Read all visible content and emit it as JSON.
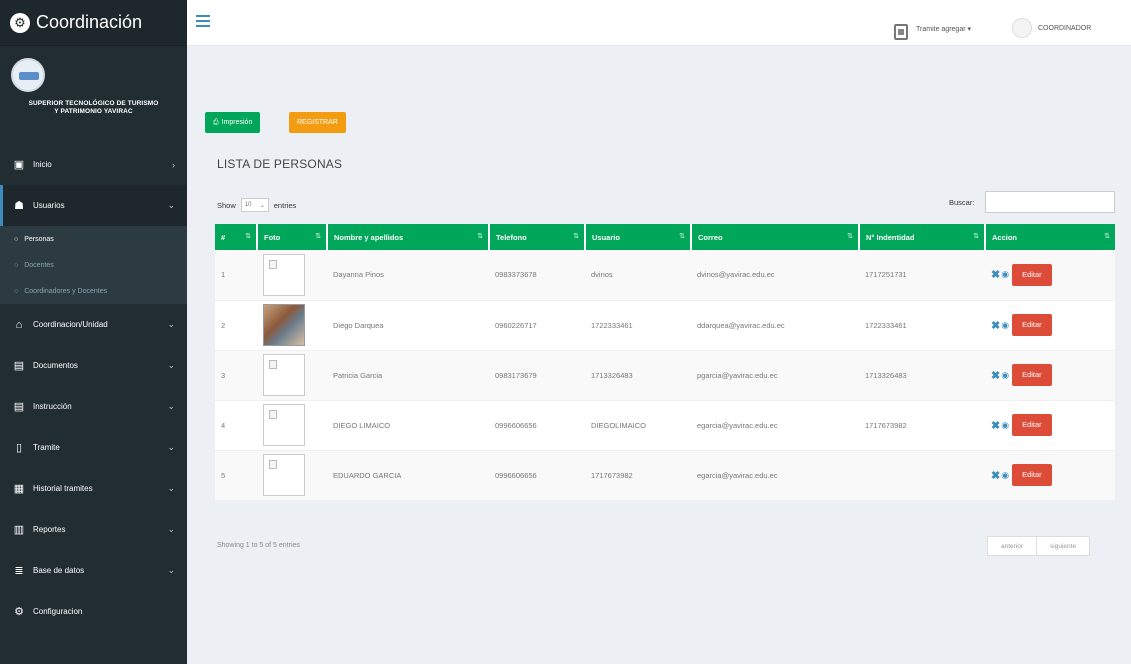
{
  "brand": {
    "title": "Coordinación",
    "icon": "gear-icon"
  },
  "institution": {
    "name_line1": "SUPERIOR TECNOLÓGICO DE TURISMO",
    "name_line2": "Y PATRIMONIO YAVIRAC"
  },
  "sidebar": {
    "items": [
      {
        "label": "Inicio",
        "icon": "dashboard-icon"
      },
      {
        "label": "Usuarios",
        "icon": "users-icon"
      },
      {
        "label": "Coordinacion/Unidad",
        "icon": "bank-icon"
      },
      {
        "label": "Documentos",
        "icon": "documents-icon"
      },
      {
        "label": "Instrucción",
        "icon": "education-icon"
      },
      {
        "label": "Tramite",
        "icon": "file-icon"
      },
      {
        "label": "Historial tramites",
        "icon": "calendar-icon"
      },
      {
        "label": "Reportes",
        "icon": "bar-chart-icon"
      },
      {
        "label": "Base de datos",
        "icon": "database-icon"
      },
      {
        "label": "Configuracion",
        "icon": "gear-icon"
      }
    ],
    "submenu": [
      "Personas",
      "Docentes",
      "Coordinadores y Docentes"
    ]
  },
  "header": {
    "tramite_label": "Tramite agregar ▾",
    "user_label": "COORDINADOR"
  },
  "toolbar": {
    "print_label": "Impresión",
    "register_label": "REGISTRAR"
  },
  "page": {
    "title": "LISTA DE PERSONAS",
    "show_label": "Show",
    "entries_value": "10",
    "entries_label": "entries",
    "search_label": "Buscar:"
  },
  "table": {
    "columns": [
      "#",
      "Foto",
      "Nombre y apellidos",
      "Telefono",
      "Usuario",
      "Correo",
      "N° Indentidad",
      "Accion"
    ],
    "rows": [
      {
        "num": "1",
        "name": "Dayanna Pinos",
        "phone": "0983373678",
        "user": "dvinos",
        "email": "dvinos@yavirac.edu.ec",
        "id": "1717251731",
        "photo": "broken"
      },
      {
        "num": "2",
        "name": "Diego Darquea",
        "phone": "0960226717",
        "user": "1722333461",
        "email": "ddarquea@yavirac.edu.ec",
        "id": "1722333461",
        "photo": "real"
      },
      {
        "num": "3",
        "name": "Patricia Garcia",
        "phone": "0983173679",
        "user": "1713326483",
        "email": "pgarcia@yavirac.edu.ec",
        "id": "1713326483",
        "photo": "broken"
      },
      {
        "num": "4",
        "name": "DIEGO LIMAICO",
        "phone": "0996606656",
        "user": "DIEGOLIMAICO",
        "email": "egarcia@yavirac.edu.ec",
        "id": "1717673982",
        "photo": "broken"
      },
      {
        "num": "5",
        "name": "EDUARDO GARCIA",
        "phone": "0996606656",
        "user": "1717673982",
        "email": "egarcia@yavirac.edu.ec",
        "id": "",
        "photo": "broken"
      }
    ],
    "edit_label": "Editar"
  },
  "footer": {
    "info": "Showing 1 to 5 of 5 entries",
    "prev_label": "anterior",
    "next_label": "siguiente"
  },
  "colors": {
    "sidebar": "#222d32",
    "primary_green": "#00a65a",
    "orange": "#f39c12",
    "red": "#dd4b39",
    "blue": "#3c8dbc"
  }
}
